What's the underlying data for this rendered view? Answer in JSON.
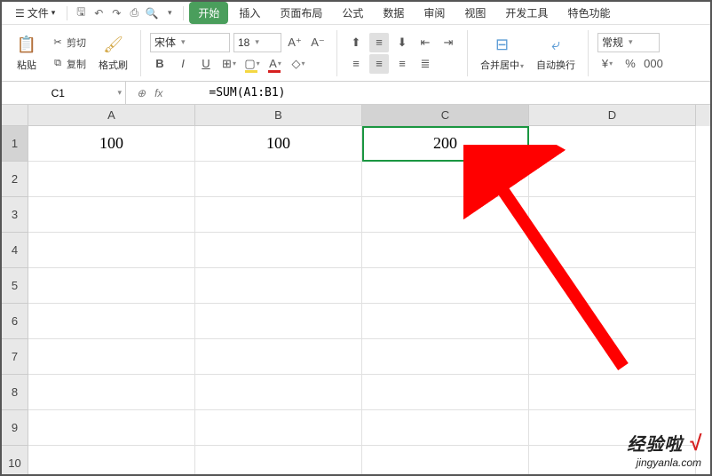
{
  "menubar": {
    "file_label": "文件",
    "tabs": [
      "开始",
      "插入",
      "页面布局",
      "公式",
      "数据",
      "审阅",
      "视图",
      "开发工具",
      "特色功能"
    ]
  },
  "ribbon": {
    "paste": "粘贴",
    "cut": "剪切",
    "copy": "复制",
    "format_painter": "格式刷",
    "font_name": "宋体",
    "font_size": "18",
    "merge": "合并居中",
    "wrap": "自动换行",
    "number_format": "常规",
    "currency": "¥",
    "percent": "%",
    "thousands": "000"
  },
  "formula_bar": {
    "cell_ref": "C1",
    "fx": "fx",
    "formula": "=SUM(A1:B1)"
  },
  "grid": {
    "columns": [
      "A",
      "B",
      "C",
      "D"
    ],
    "rows": [
      "1",
      "2",
      "3",
      "4",
      "5",
      "6",
      "7",
      "8",
      "9",
      "10"
    ],
    "data": {
      "A1": "100",
      "B1": "100",
      "C1": "200"
    }
  },
  "watermark": {
    "line1": "经验啦",
    "check": "√",
    "line2": "jingyanla.com"
  }
}
